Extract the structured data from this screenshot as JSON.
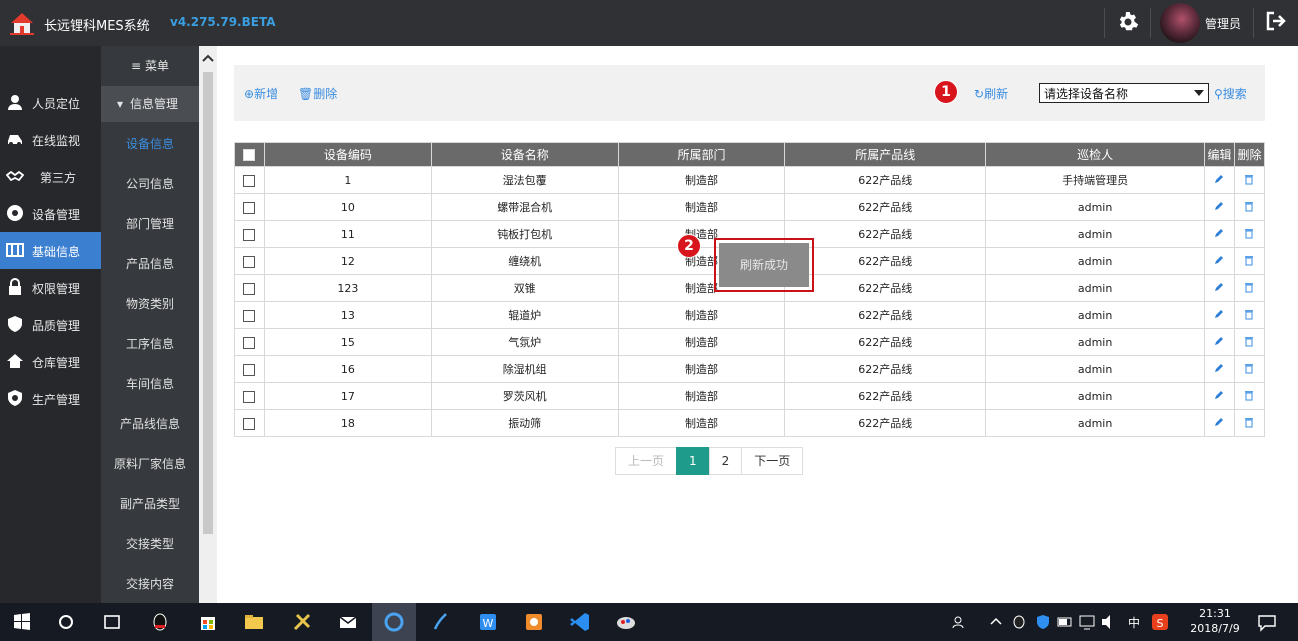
{
  "header": {
    "app_title": "长远锂科MES系统",
    "version": "v4.275.79.BETA",
    "user_name": "管理员",
    "icons": [
      "logo-icon",
      "gear-icon",
      "logout-icon"
    ]
  },
  "primary_nav": [
    {
      "label": "人员定位",
      "icon": "person-pin-icon"
    },
    {
      "label": "在线监视",
      "icon": "car-icon"
    },
    {
      "label": "第三方",
      "icon": "handshake-icon"
    },
    {
      "label": "设备管理",
      "icon": "device-icon"
    },
    {
      "label": "基础信息",
      "icon": "grid-icon",
      "active": true
    },
    {
      "label": "权限管理",
      "icon": "lock-icon"
    },
    {
      "label": "品质管理",
      "icon": "shield-icon"
    },
    {
      "label": "仓库管理",
      "icon": "house-icon"
    },
    {
      "label": "生产管理",
      "icon": "gear-shield-icon"
    }
  ],
  "secondary_nav": {
    "menu_label": "菜单",
    "group_label": "信息管理",
    "items": [
      "设备信息",
      "公司信息",
      "部门管理",
      "产品信息",
      "物资类别",
      "工序信息",
      "车间信息",
      "产品线信息",
      "原料厂家信息",
      "副产品类型",
      "交接类型",
      "交接内容"
    ],
    "active_index": 0
  },
  "toolbar": {
    "add_label": "新增",
    "delete_label": "删除",
    "refresh_label": "刷新",
    "select_value": "请选择设备名称",
    "search_label": "搜索",
    "badge_1": "1",
    "badge_2": "2"
  },
  "table": {
    "columns": [
      "设备编码",
      "设备名称",
      "所属部门",
      "所属产品线",
      "巡检人",
      "编辑",
      "删除"
    ],
    "rows": [
      [
        "1",
        "湿法包覆",
        "制造部",
        "622产品线",
        "手持端管理员"
      ],
      [
        "10",
        "螺带混合机",
        "制造部",
        "622产品线",
        "admin"
      ],
      [
        "11",
        "钝板打包机",
        "制造部",
        "622产品线",
        "admin"
      ],
      [
        "12",
        "缠绕机",
        "制造部",
        "622产品线",
        "admin"
      ],
      [
        "123",
        "双锥",
        "制造部",
        "622产品线",
        "admin"
      ],
      [
        "13",
        "辊道炉",
        "制造部",
        "622产品线",
        "admin"
      ],
      [
        "15",
        "气氛炉",
        "制造部",
        "622产品线",
        "admin"
      ],
      [
        "16",
        "除湿机组",
        "制造部",
        "622产品线",
        "admin"
      ],
      [
        "17",
        "罗茨风机",
        "制造部",
        "622产品线",
        "admin"
      ],
      [
        "18",
        "振动筛",
        "制造部",
        "622产品线",
        "admin"
      ]
    ]
  },
  "pagination": {
    "prev": "上一页",
    "pages": [
      "1",
      "2"
    ],
    "current": "1",
    "next": "下一页"
  },
  "toast": {
    "text": "刷新成功"
  },
  "taskbar": {
    "time": "21:31",
    "date": "2018/7/9",
    "ime": "中"
  },
  "colors": {
    "accent": "#3b7fd1",
    "link": "#3a8de0",
    "page_current": "#1e9b8a",
    "badge": "#d8141c",
    "topbar": "#2f3134"
  }
}
